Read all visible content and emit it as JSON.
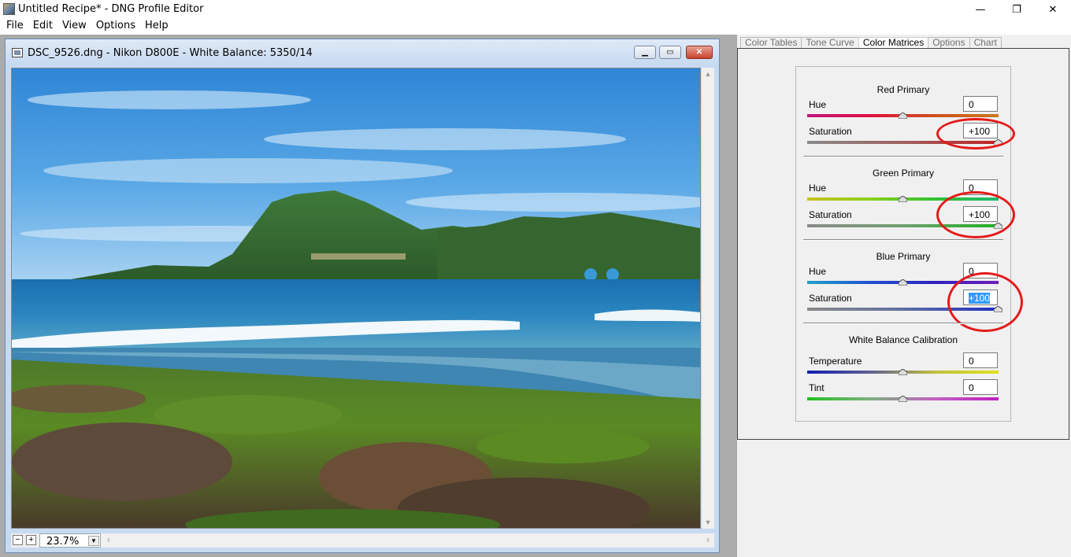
{
  "app": {
    "window_title": "Untitled Recipe* - DNG Profile Editor",
    "controls": {
      "minimize": "—",
      "maximize": "❐",
      "close": "✕"
    }
  },
  "menu": [
    "File",
    "Edit",
    "View",
    "Options",
    "Help"
  ],
  "image_window": {
    "caption": "DSC_9526.dng  - Nikon D800E - White Balance: 5350/14",
    "zoom_value": "23.7%",
    "zoom_out_label": "−",
    "zoom_in_label": "+"
  },
  "tabs": [
    {
      "label": "Color Tables",
      "active": false
    },
    {
      "label": "Tone Curve",
      "active": false
    },
    {
      "label": "Color Matrices",
      "active": true
    },
    {
      "label": "Options",
      "active": false
    },
    {
      "label": "Chart",
      "active": false
    }
  ],
  "color_matrices": {
    "red": {
      "title": "Red Primary",
      "hue_label": "Hue",
      "hue_value": "0",
      "hue_level": 0,
      "sat_label": "Saturation",
      "sat_value": "+100",
      "sat_level": 100,
      "highlighted": true
    },
    "green": {
      "title": "Green Primary",
      "hue_label": "Hue",
      "hue_value": "0",
      "hue_level": 0,
      "sat_label": "Saturation",
      "sat_value": "+100",
      "sat_level": 100,
      "highlighted": true
    },
    "blue": {
      "title": "Blue Primary",
      "hue_label": "Hue",
      "hue_value": "0",
      "hue_level": 0,
      "sat_label": "Saturation",
      "sat_value": "+100",
      "sat_level": 100,
      "highlighted": true,
      "sat_selected": true
    },
    "white_balance": {
      "title": "White Balance Calibration",
      "temp_label": "Temperature",
      "temp_value": "0",
      "temp_level": 0,
      "tint_label": "Tint",
      "tint_value": "0",
      "tint_level": 0
    }
  },
  "colors": {
    "annotation_circle": "#e41a1a",
    "selection": "#3399ff"
  }
}
